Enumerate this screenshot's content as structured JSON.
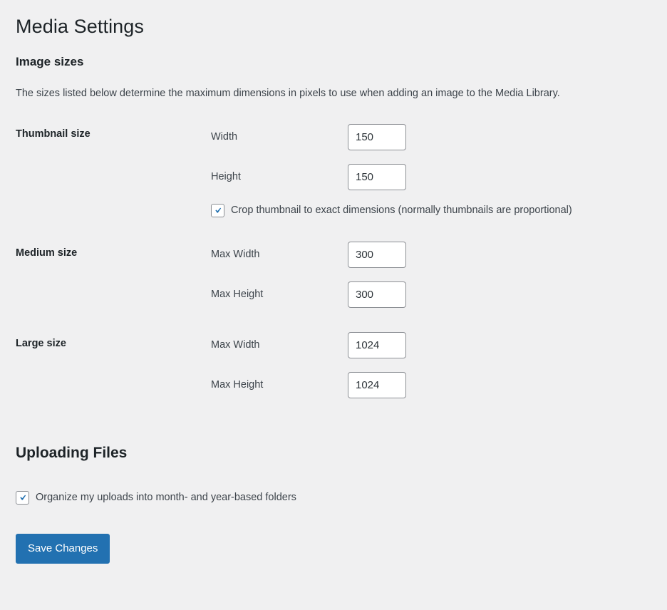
{
  "page": {
    "title": "Media Settings"
  },
  "image_sizes": {
    "heading": "Image sizes",
    "description": "The sizes listed below determine the maximum dimensions in pixels to use when adding an image to the Media Library.",
    "rows": [
      {
        "label": "Thumbnail size",
        "fields": [
          {
            "label": "Width",
            "value": "150"
          },
          {
            "label": "Height",
            "value": "150"
          }
        ],
        "checkbox": {
          "label": "Crop thumbnail to exact dimensions (normally thumbnails are proportional)",
          "checked": true,
          "icon": "checkmark-icon"
        }
      },
      {
        "label": "Medium size",
        "fields": [
          {
            "label": "Max Width",
            "value": "300"
          },
          {
            "label": "Max Height",
            "value": "300"
          }
        ]
      },
      {
        "label": "Large size",
        "fields": [
          {
            "label": "Max Width",
            "value": "1024"
          },
          {
            "label": "Max Height",
            "value": "1024"
          }
        ]
      }
    ]
  },
  "uploading_files": {
    "heading": "Uploading Files",
    "checkbox": {
      "label": "Organize my uploads into month- and year-based folders",
      "checked": true,
      "icon": "checkmark-icon"
    }
  },
  "submit": {
    "label": "Save Changes"
  },
  "colors": {
    "background": "#f0f0f1",
    "accent": "#2271b1",
    "heading_text": "#1d2327",
    "body_text": "#3c434a",
    "input_border": "#8c8f94",
    "input_background": "#ffffff"
  }
}
